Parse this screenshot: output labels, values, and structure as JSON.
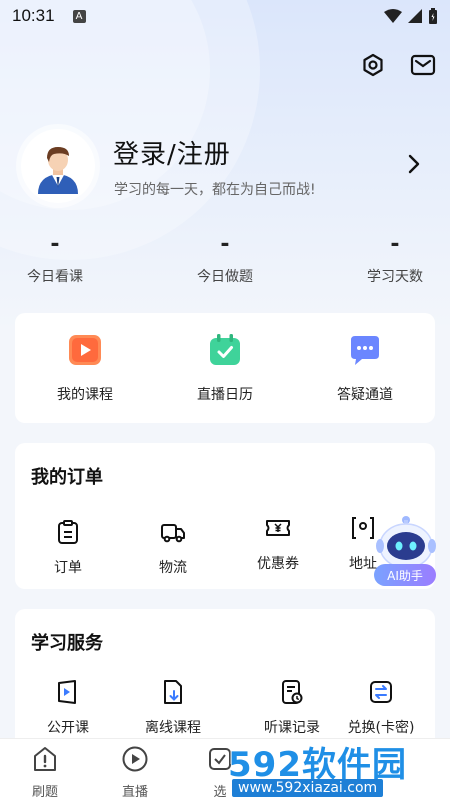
{
  "status_bar": {
    "time": "10:31",
    "notice": "A"
  },
  "profile": {
    "title": "登录/注册",
    "subtitle": "学习的每一天，都在为自己而战!"
  },
  "stats": [
    {
      "value": "-",
      "label": "今日看课"
    },
    {
      "value": "-",
      "label": "今日做题"
    },
    {
      "value": "-",
      "label": "学习天数"
    }
  ],
  "quick_actions": [
    {
      "label": "我的课程",
      "icon": "play-icon",
      "color": "#ff7a45"
    },
    {
      "label": "直播日历",
      "icon": "calendar-check-icon",
      "color": "#36c98a"
    },
    {
      "label": "答疑通道",
      "icon": "chat-icon",
      "color": "#5b7cff"
    }
  ],
  "orders": {
    "title": "我的订单",
    "items": [
      {
        "label": "订单",
        "icon": "clipboard-icon"
      },
      {
        "label": "物流",
        "icon": "truck-icon"
      },
      {
        "label": "优惠券",
        "icon": "coupon-icon"
      },
      {
        "label": "地址",
        "icon": "address-icon"
      }
    ]
  },
  "services": {
    "title": "学习服务",
    "items": [
      {
        "label": "公开课",
        "icon": "video-book-icon"
      },
      {
        "label": "离线课程",
        "icon": "download-file-icon"
      },
      {
        "label": "听课记录",
        "icon": "history-doc-icon"
      },
      {
        "label": "兑换(卡密)",
        "icon": "exchange-icon"
      }
    ]
  },
  "ai_assistant": {
    "label": "AI助手"
  },
  "bottom_nav": [
    {
      "label": "刷题",
      "icon": "home-alert-icon"
    },
    {
      "label": "直播",
      "icon": "live-play-icon"
    },
    {
      "label": "选",
      "icon": "select-icon"
    }
  ],
  "watermark": {
    "brand": "592软件园",
    "url": "www.592xiazai.com"
  },
  "colors": {
    "background": "#f3f6fb",
    "accent": "#5b7cff"
  }
}
